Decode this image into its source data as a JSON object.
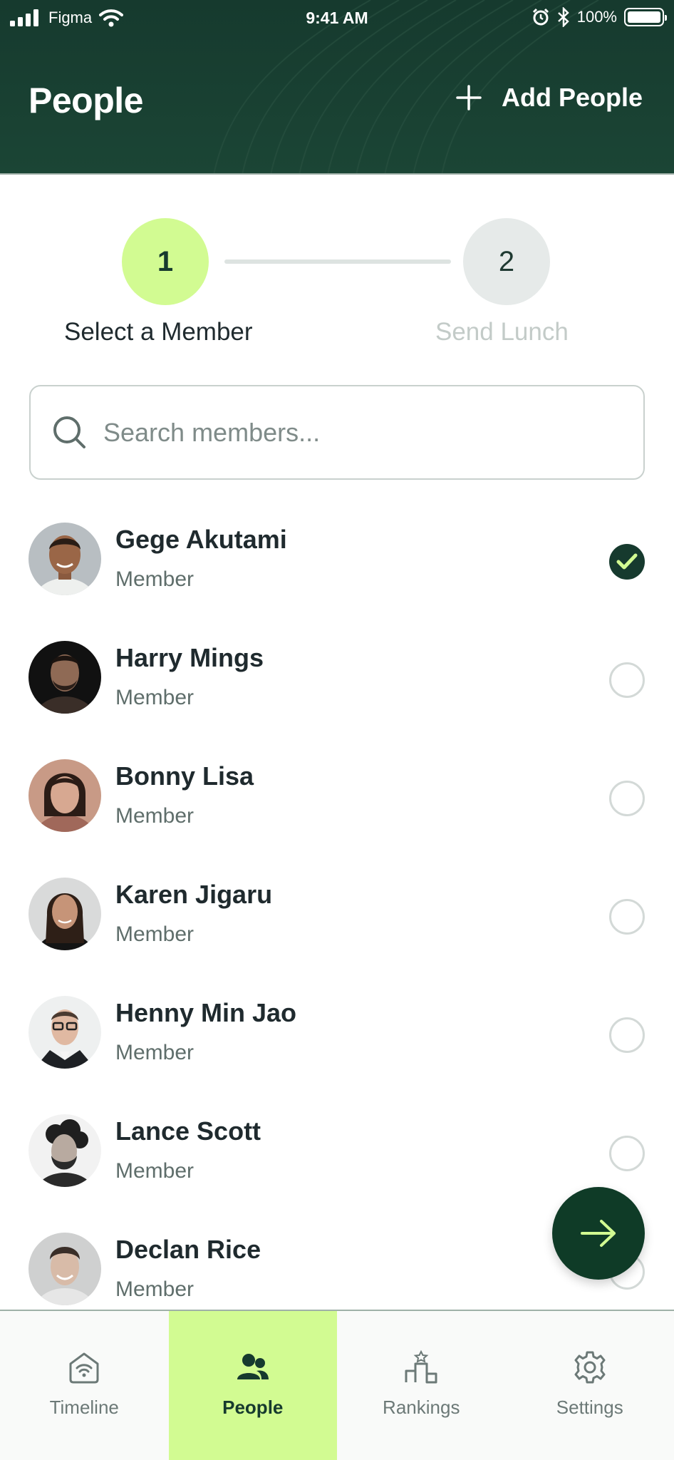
{
  "status_bar": {
    "carrier": "Figma",
    "time": "9:41 AM",
    "battery": "100%"
  },
  "header": {
    "title": "People",
    "add_label": "Add People"
  },
  "stepper": {
    "steps": [
      {
        "number": "1",
        "label": "Select a Member"
      },
      {
        "number": "2",
        "label": "Send Lunch"
      }
    ]
  },
  "search": {
    "placeholder": "Search members...",
    "value": ""
  },
  "members": [
    {
      "name": "Gege Akutami",
      "role": "Member",
      "selected": true
    },
    {
      "name": "Harry Mings",
      "role": "Member",
      "selected": false
    },
    {
      "name": "Bonny Lisa",
      "role": "Member",
      "selected": false
    },
    {
      "name": "Karen Jigaru",
      "role": "Member",
      "selected": false
    },
    {
      "name": "Henny Min Jao",
      "role": "Member",
      "selected": false
    },
    {
      "name": "Lance Scott",
      "role": "Member",
      "selected": false
    },
    {
      "name": "Declan Rice",
      "role": "Member",
      "selected": false
    }
  ],
  "nav": {
    "items": [
      {
        "label": "Timeline",
        "icon": "home-wifi-icon"
      },
      {
        "label": "People",
        "icon": "people-icon"
      },
      {
        "label": "Rankings",
        "icon": "podium-icon"
      },
      {
        "label": "Settings",
        "icon": "gear-icon"
      }
    ],
    "active": "People"
  },
  "colors": {
    "header_bg": "#163a2e",
    "accent": "#d2fb92",
    "fab_bg": "#0f3b27"
  }
}
